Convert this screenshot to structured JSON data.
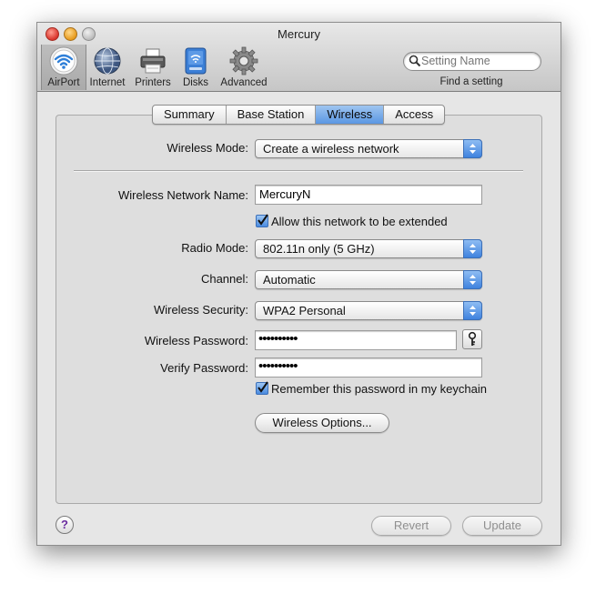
{
  "window": {
    "title": "Mercury"
  },
  "toolbar": {
    "items": [
      {
        "label": "AirPort",
        "icon": "airport-wifi-icon",
        "selected": true
      },
      {
        "label": "Internet",
        "icon": "globe-icon",
        "selected": false
      },
      {
        "label": "Printers",
        "icon": "printer-icon",
        "selected": false
      },
      {
        "label": "Disks",
        "icon": "disk-icon",
        "selected": false
      },
      {
        "label": "Advanced",
        "icon": "gear-icon",
        "selected": false
      }
    ],
    "search": {
      "placeholder": "Setting Name",
      "caption": "Find a setting"
    }
  },
  "tabs": [
    {
      "label": "Summary",
      "active": false
    },
    {
      "label": "Base Station",
      "active": false
    },
    {
      "label": "Wireless",
      "active": true
    },
    {
      "label": "Access",
      "active": false
    }
  ],
  "form": {
    "wireless_mode": {
      "label": "Wireless Mode:",
      "value": "Create a wireless network"
    },
    "network_name": {
      "label": "Wireless Network Name:",
      "value": "MercuryN"
    },
    "allow_extended": {
      "label": "Allow this network to be extended",
      "checked": true
    },
    "radio_mode": {
      "label": "Radio Mode:",
      "value": "802.11n only (5 GHz)"
    },
    "channel": {
      "label": "Channel:",
      "value": "Automatic"
    },
    "security": {
      "label": "Wireless Security:",
      "value": "WPA2 Personal"
    },
    "password": {
      "label": "Wireless Password:",
      "value": "••••••••••"
    },
    "verify": {
      "label": "Verify Password:",
      "value": "••••••••••"
    },
    "remember": {
      "label": "Remember this password in my keychain",
      "checked": true
    },
    "options_button": "Wireless Options..."
  },
  "footer": {
    "help": "?",
    "revert": "Revert",
    "update": "Update"
  },
  "colors": {
    "selected_tab": "#5a97e3",
    "help_glyph": "#6a2c9e"
  }
}
